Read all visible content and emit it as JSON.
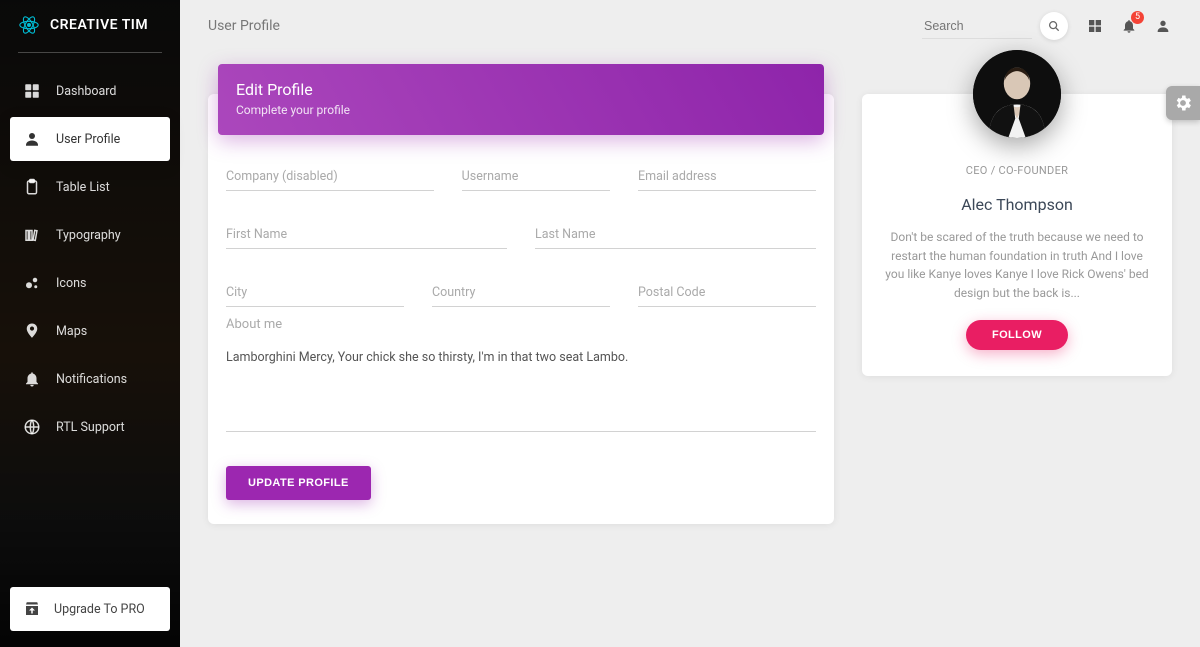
{
  "brand": {
    "name": "CREATIVE TIM"
  },
  "sidebar": {
    "items": [
      {
        "label": "Dashboard"
      },
      {
        "label": "User Profile"
      },
      {
        "label": "Table List"
      },
      {
        "label": "Typography"
      },
      {
        "label": "Icons"
      },
      {
        "label": "Maps"
      },
      {
        "label": "Notifications"
      },
      {
        "label": "RTL Support"
      }
    ],
    "upgrade_label": "Upgrade To PRO"
  },
  "topbar": {
    "page_title": "User Profile",
    "search_placeholder": "Search",
    "notification_count": "5"
  },
  "form": {
    "header_title": "Edit Profile",
    "header_sub": "Complete your profile",
    "company_placeholder": "Company (disabled)",
    "username_placeholder": "Username",
    "email_placeholder": "Email address",
    "firstname_placeholder": "First Name",
    "lastname_placeholder": "Last Name",
    "city_placeholder": "City",
    "country_placeholder": "Country",
    "postal_placeholder": "Postal Code",
    "about_label": "About me",
    "about_value": "Lamborghini Mercy, Your chick she so thirsty, I'm in that two seat Lambo.",
    "submit_label": "UPDATE PROFILE"
  },
  "profile": {
    "role": "CEO / CO-FOUNDER",
    "name": "Alec Thompson",
    "bio": "Don't be scared of the truth because we need to restart the human foundation in truth And I love you like Kanye loves Kanye I love Rick Owens' bed design but the back is...",
    "follow_label": "FOLLOW"
  }
}
